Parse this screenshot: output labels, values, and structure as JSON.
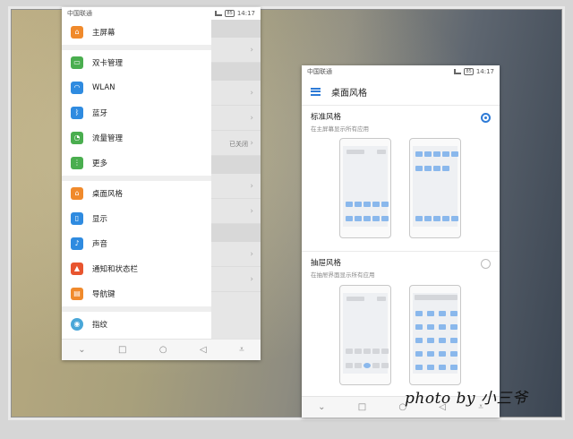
{
  "status": {
    "carrier": "中国联通",
    "time": "14:17",
    "battery": "85"
  },
  "left": {
    "items": [
      {
        "label": "主屏幕",
        "icon": "home-icon",
        "color": "#f08a2c"
      },
      {
        "label": "双卡管理",
        "icon": "sim-icon",
        "color": "#4aae4f"
      },
      {
        "label": "WLAN",
        "icon": "wifi-icon",
        "color": "#2f8be0"
      },
      {
        "label": "蓝牙",
        "icon": "bluetooth-icon",
        "color": "#2f8be0"
      },
      {
        "label": "流量管理",
        "icon": "data-usage-icon",
        "color": "#4aae4f"
      },
      {
        "label": "更多",
        "icon": "more-icon",
        "color": "#4aae4f"
      },
      {
        "label": "桌面风格",
        "icon": "home-style-icon",
        "color": "#f08a2c"
      },
      {
        "label": "显示",
        "icon": "display-icon",
        "color": "#2f8be0"
      },
      {
        "label": "声音",
        "icon": "sound-icon",
        "color": "#2f8be0"
      },
      {
        "label": "通知和状态栏",
        "icon": "notification-icon",
        "color": "#e8552f"
      },
      {
        "label": "导航键",
        "icon": "navigation-key-icon",
        "color": "#f08a2c"
      },
      {
        "label": "指纹",
        "icon": "fingerprint-icon",
        "color": "#4aa7d8"
      }
    ],
    "behind_value": "已关闭"
  },
  "right": {
    "title": "桌面风格",
    "standard": {
      "title": "标准风格",
      "subtitle": "在主屏幕显示所有应用",
      "selected": true
    },
    "drawer": {
      "title": "抽屉风格",
      "subtitle": "在抽屉界面显示所有应用",
      "selected": false
    }
  },
  "watermark": "photo by 小三爷",
  "colors": {
    "accent": "#2e7bd7",
    "tile": "#8ab8ec"
  }
}
